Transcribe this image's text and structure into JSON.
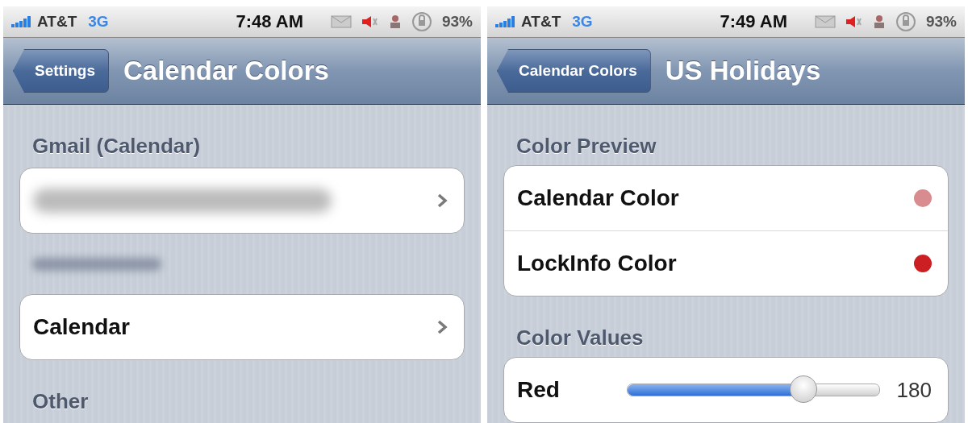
{
  "screens": [
    {
      "status_bar": {
        "carrier": "AT&T",
        "network": "3G",
        "time": "7:48 AM",
        "battery": "93%"
      },
      "nav_bar": {
        "back_button": "Settings",
        "title": "Calendar Colors"
      },
      "sections": [
        {
          "kind": "titled",
          "header": "Gmail (Calendar)",
          "rows": [
            {
              "kind": "blurred_link"
            }
          ]
        },
        {
          "kind": "blurred",
          "rows": [
            {
              "kind": "link",
              "label": "Calendar"
            }
          ]
        },
        {
          "kind": "titled",
          "header": "Other"
        }
      ]
    },
    {
      "status_bar": {
        "carrier": "AT&T",
        "network": "3G",
        "time": "7:49 AM",
        "battery": "93%"
      },
      "nav_bar": {
        "back_button": "Calendar Colors",
        "title": "US Holidays"
      },
      "sections": [
        {
          "kind": "titled",
          "header": "Color Preview",
          "rows": [
            {
              "kind": "color",
              "label": "Calendar Color",
              "color": "#d98c90"
            },
            {
              "kind": "color",
              "label": "LockInfo Color",
              "color": "#cc1f24"
            }
          ]
        },
        {
          "kind": "titled",
          "header": "Color Values",
          "rows": [
            {
              "kind": "slider",
              "label": "Red",
              "level": 0.7,
              "reading": "180"
            }
          ]
        }
      ]
    }
  ]
}
